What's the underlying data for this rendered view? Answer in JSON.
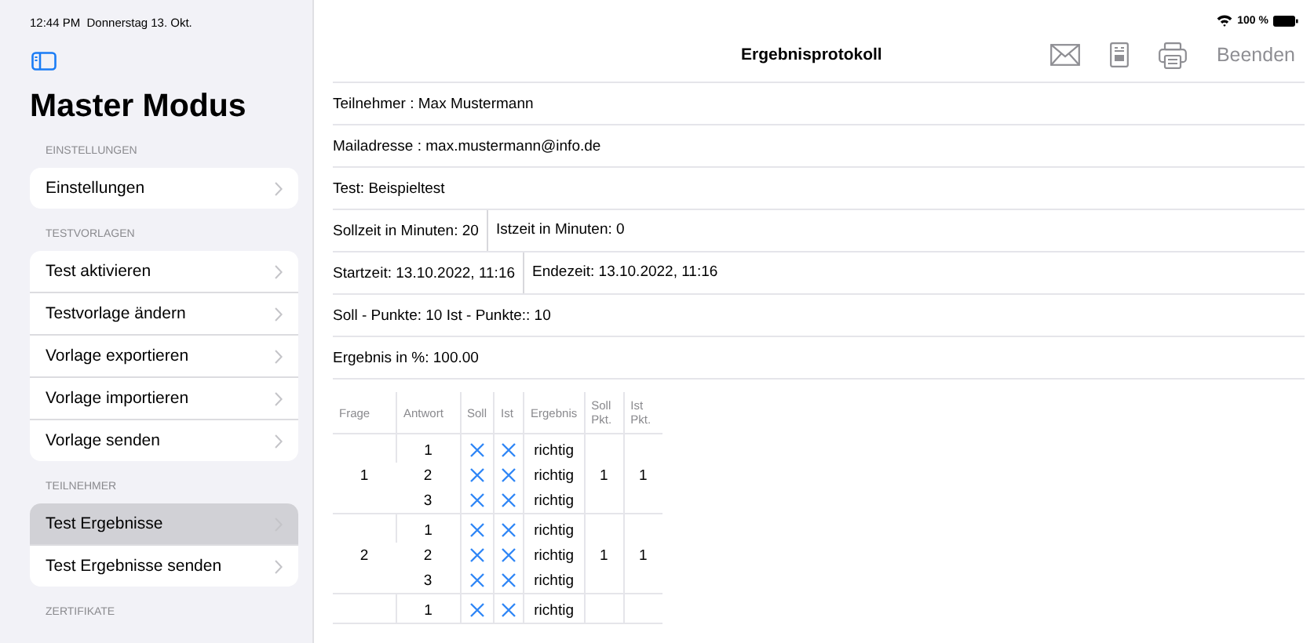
{
  "status_bar": {
    "time": "12:44 PM",
    "date": "Donnerstag 13. Okt.",
    "battery_text": "100 %"
  },
  "sidebar": {
    "title": "Master Modus",
    "sections": [
      {
        "header": "EINSTELLUNGEN",
        "items": [
          {
            "label": "Einstellungen",
            "selected": false
          }
        ]
      },
      {
        "header": "TESTVORLAGEN",
        "items": [
          {
            "label": "Test aktivieren",
            "selected": false
          },
          {
            "label": "Testvorlage ändern",
            "selected": false
          },
          {
            "label": "Vorlage exportieren",
            "selected": false
          },
          {
            "label": "Vorlage importieren",
            "selected": false
          },
          {
            "label": "Vorlage senden",
            "selected": false
          }
        ]
      },
      {
        "header": "TEILNEHMER",
        "items": [
          {
            "label": "Test Ergebnisse",
            "selected": true
          },
          {
            "label": "Test Ergebnisse senden",
            "selected": false
          }
        ]
      },
      {
        "header": "ZERTIFIKATE"
      }
    ]
  },
  "navbar": {
    "title": "Ergebnisprotokoll",
    "done_button": "Beenden"
  },
  "info_rows": [
    {
      "parts": [
        "Teilnehmer : Max Mustermann"
      ]
    },
    {
      "parts": [
        "Mailadresse : max.mustermann@info.de"
      ]
    },
    {
      "parts": [
        "Test: Beispieltest"
      ]
    },
    {
      "parts": [
        "Sollzeit in Minuten: 20",
        "Istzeit in Minuten: 0"
      ]
    },
    {
      "parts": [
        "Startzeit: 13.10.2022, 11:16",
        "Endezeit: 13.10.2022, 11:16"
      ]
    },
    {
      "parts": [
        "Soll - Punkte: 10 Ist - Punkte:: 10"
      ]
    },
    {
      "parts": [
        "Ergebnis in %: 100.00"
      ]
    }
  ],
  "table": {
    "columns": [
      "Frage",
      "Antwort",
      "Soll",
      "Ist",
      "Ergebnis",
      "Soll Pkt.",
      "Ist Pkt."
    ],
    "questions": [
      {
        "number": "1",
        "soll_points": "1",
        "ist_points": "1",
        "answers": [
          {
            "number": "1",
            "soll": true,
            "ist": true,
            "result": "richtig"
          },
          {
            "number": "2",
            "soll": true,
            "ist": true,
            "result": "richtig"
          },
          {
            "number": "3",
            "soll": true,
            "ist": true,
            "result": "richtig"
          }
        ]
      },
      {
        "number": "2",
        "soll_points": "1",
        "ist_points": "1",
        "answers": [
          {
            "number": "1",
            "soll": true,
            "ist": true,
            "result": "richtig"
          },
          {
            "number": "2",
            "soll": true,
            "ist": true,
            "result": "richtig"
          },
          {
            "number": "3",
            "soll": true,
            "ist": true,
            "result": "richtig"
          }
        ]
      },
      {
        "answers": [
          {
            "number": "1",
            "soll": true,
            "ist": true,
            "result": "richtig"
          }
        ]
      }
    ]
  }
}
